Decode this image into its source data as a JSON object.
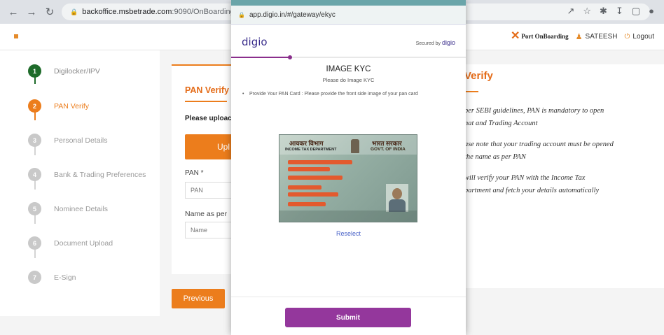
{
  "browser": {
    "address_host": "backoffice.msbetrade.com",
    "address_path": ":9090/OnBoarding/steps"
  },
  "header": {
    "brand_small": "",
    "port_logo_text": "Port OnBoarding",
    "user_name": "SATEESH",
    "logout_label": "Logout"
  },
  "steps": [
    {
      "num": "1",
      "label": "Digilocker/IPV",
      "state": "done"
    },
    {
      "num": "2",
      "label": "PAN Verify",
      "state": "active"
    },
    {
      "num": "3",
      "label": "Personal Details",
      "state": "todo"
    },
    {
      "num": "4",
      "label": "Bank & Trading Preferences",
      "state": "todo"
    },
    {
      "num": "5",
      "label": "Nominee Details",
      "state": "todo"
    },
    {
      "num": "6",
      "label": "Document Upload",
      "state": "todo"
    },
    {
      "num": "7",
      "label": "E-Sign",
      "state": "todo"
    }
  ],
  "form": {
    "title": "PAN Verify",
    "upload_prompt": "Please uploac",
    "upload_button": "Upl",
    "pan_label": "PAN *",
    "pan_placeholder": "PAN",
    "name_label": "Name as per",
    "name_placeholder": "Name",
    "previous_button": "Previous"
  },
  "info": {
    "title": "Verify",
    "p1_line1": "per SEBI guidelines, PAN is mandatory to open",
    "p1_line2": "nat and Trading Account",
    "p2_line1": "ase note that your trading account must be opened",
    "p2_line2": "the name as per PAN",
    "p3_line1": "will verify your PAN with the Income Tax",
    "p3_line2": "partment and fetch your details automatically"
  },
  "popup": {
    "url": "app.digio.in/#/gateway/ekyc",
    "logo": "digio",
    "secured_label": "Secured by",
    "secured_brand": "digio",
    "progress_fraction": 0.25,
    "kyc_title": "IMAGE KYC",
    "kyc_subtitle": "Please do Image KYC",
    "instruction": "Provide Your PAN Card : Please provide the front side image of your pan card",
    "card_hindi_left": "आयकर विभाग",
    "card_hindi_right": "भारत सरकार",
    "card_dept": "INCOME TAX DEPARTMENT",
    "card_govt": "GOVT. OF INDIA",
    "reselect_label": "Reselect",
    "submit_label": "Submit"
  },
  "colors": {
    "accent_orange": "#ec7d1c",
    "done_green": "#1e6b2a",
    "digio_purple": "#94379c"
  }
}
